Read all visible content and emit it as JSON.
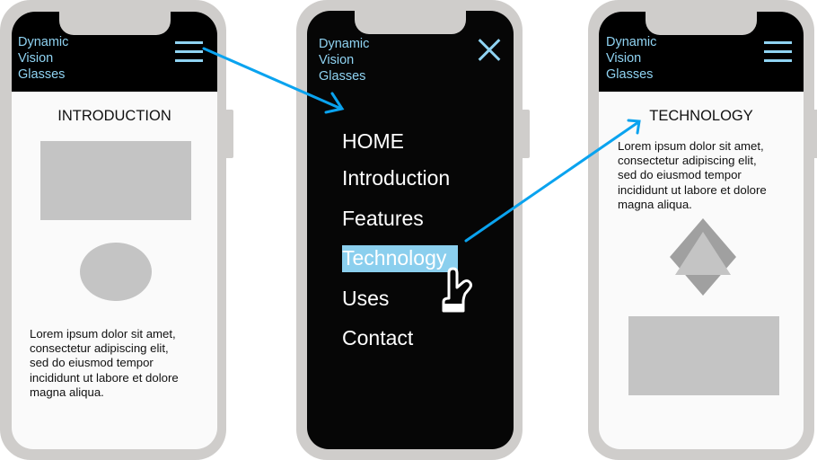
{
  "colors": {
    "accent": "#8fd3f2",
    "arrow": "#0aa3ef",
    "highlight": "#8bcfee",
    "phone_frame": "#cfcdcb",
    "placeholder": "#c4c4c4",
    "placeholder_dark": "#a0a0a0"
  },
  "brand": {
    "lines": [
      "Dynamic",
      "Vision",
      "Glasses"
    ]
  },
  "screens": [
    {
      "name": "introduction-screen",
      "header_icon": "hamburger-menu-icon",
      "title": "INTRODUCTION",
      "body_lines": [
        "Lorem ipsum dolor sit amet,",
        "consectetur adipiscing elit,",
        "sed do eiusmod tempor",
        "incididunt ut labore et dolore",
        "magna aliqua."
      ]
    },
    {
      "name": "menu-screen",
      "header_icon": "close-icon",
      "menu_items": [
        {
          "label": "HOME"
        },
        {
          "label": "Introduction"
        },
        {
          "label": "Features"
        },
        {
          "label": "Technology",
          "active": true
        },
        {
          "label": "Uses"
        },
        {
          "label": "Contact"
        }
      ],
      "cursor_icon": "pointing-hand-cursor-icon"
    },
    {
      "name": "technology-screen",
      "header_icon": "hamburger-menu-icon",
      "title": "TECHNOLOGY",
      "body_lines": [
        "Lorem ipsum dolor sit amet,",
        "consectetur adipiscing elit,",
        "sed do eiusmod tempor",
        "incididunt ut labore et dolore",
        "magna aliqua."
      ]
    }
  ],
  "flow_arrows": [
    {
      "from": "introduction-screen hamburger-menu-icon",
      "to": "menu-screen"
    },
    {
      "from": "menu-screen Technology",
      "to": "technology-screen TECHNOLOGY"
    }
  ]
}
